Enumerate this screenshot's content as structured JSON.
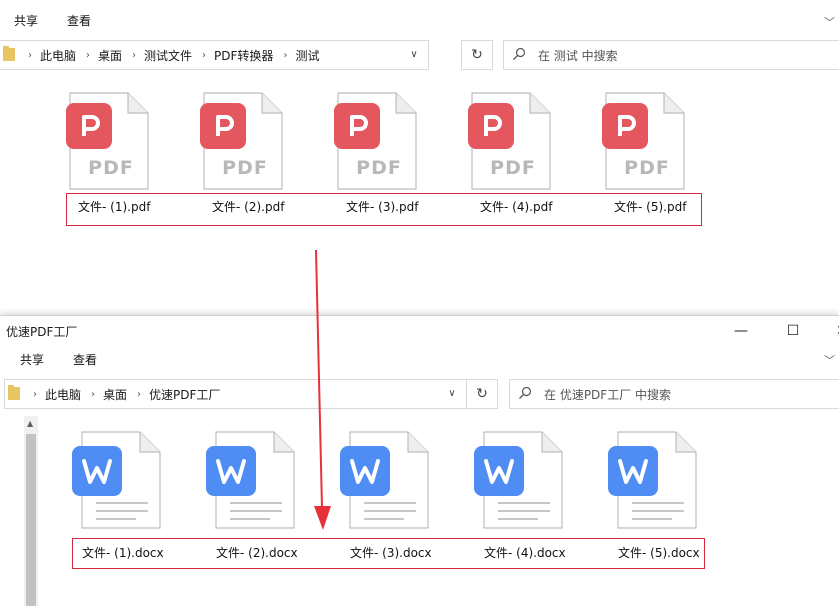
{
  "colors": {
    "pdf_badge": "#e5575f",
    "word_badge": "#4f8df5",
    "selection": "#d6283a",
    "arrow": "#e8303a",
    "folder": "#e8c463"
  },
  "top_window": {
    "ribbon": {
      "share": "共享",
      "view": "查看"
    },
    "breadcrumb": [
      "此电脑",
      "桌面",
      "测试文件",
      "PDF转换器",
      "测试"
    ],
    "search_placeholder": "在 测试 中搜索",
    "file_icon": "pdf-file-icon",
    "badge_text": "PDF",
    "files": [
      "文件- (1).pdf",
      "文件- (2).pdf",
      "文件- (3).pdf",
      "文件- (4).pdf",
      "文件- (5).pdf"
    ]
  },
  "bottom_window": {
    "title": "优速PDF工厂",
    "ribbon": {
      "share": "共享",
      "view": "查看"
    },
    "breadcrumb": [
      "此电脑",
      "桌面",
      "优速PDF工厂"
    ],
    "search_placeholder": "在 优速PDF工厂 中搜索",
    "file_icon": "word-file-icon",
    "files": [
      "文件- (1).docx",
      "文件- (2).docx",
      "文件- (3).docx",
      "文件- (4).docx",
      "文件- (5).docx"
    ]
  }
}
